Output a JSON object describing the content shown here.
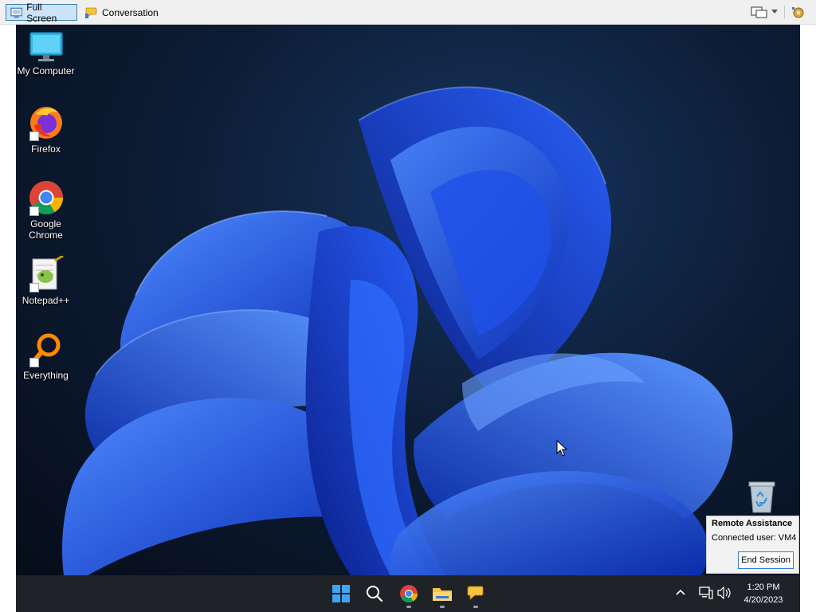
{
  "toolbar": {
    "fullscreen_label": "Full Screen",
    "conversation_label": "Conversation"
  },
  "desktop": {
    "icons": [
      {
        "label": "My Computer",
        "icon": "monitor-icon"
      },
      {
        "label": "Firefox",
        "icon": "firefox-icon"
      },
      {
        "label": "Google Chrome",
        "icon": "chrome-icon"
      },
      {
        "label": "Notepad++",
        "icon": "notepadpp-icon"
      },
      {
        "label": "Everything",
        "icon": "everything-search-icon"
      }
    ],
    "recycle_bin_icon": "recycle-bin-icon"
  },
  "remote_assistance": {
    "title": "Remote Assistance",
    "connected_user": "Connected user:  VM4",
    "end_session_label": "End Session"
  },
  "taskbar": {
    "apps": [
      "start-icon",
      "search-icon",
      "chrome-icon",
      "file-explorer-icon",
      "remote-assistance-icon"
    ],
    "time": "1:20 PM",
    "date": "4/20/2023"
  },
  "colors": {
    "accent": "#1a5cff",
    "taskbar": "#1f2328",
    "toolbar": "#f0f0f0",
    "active_button": "#cce4f7"
  }
}
